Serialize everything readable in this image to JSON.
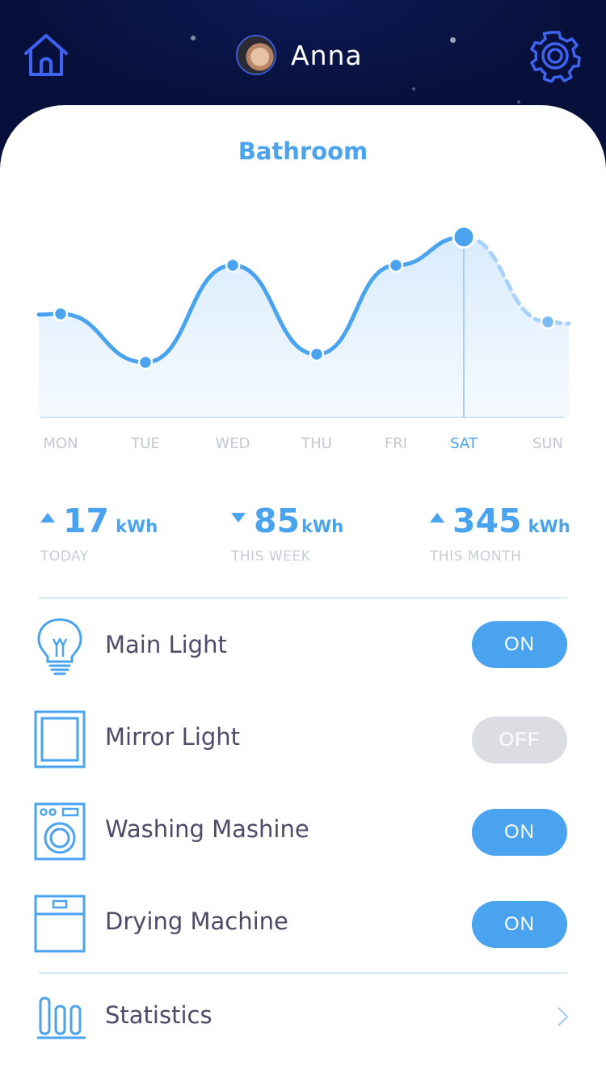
{
  "header": {
    "user_name": "Anna"
  },
  "room": {
    "title": "Bathroom"
  },
  "chart_data": {
    "type": "line",
    "categories": [
      "MON",
      "TUE",
      "WED",
      "THU",
      "FRI",
      "SAT",
      "SUN"
    ],
    "values": [
      5.2,
      2.8,
      7.6,
      3.2,
      7.6,
      9.0,
      4.8
    ],
    "selected_index": 5,
    "ylim": [
      0,
      10
    ],
    "grid": false
  },
  "stats": [
    {
      "value": "17",
      "unit": "kWh",
      "label": "TODAY",
      "trend": "up"
    },
    {
      "value": "85",
      "unit": "kWh",
      "label": "THIS WEEK",
      "trend": "down"
    },
    {
      "value": "345",
      "unit": "kWh",
      "label": "THIS MONTH",
      "trend": "up"
    }
  ],
  "devices": [
    {
      "name": "Main Light",
      "state": "ON",
      "icon": "bulb-icon"
    },
    {
      "name": "Mirror Light",
      "state": "OFF",
      "icon": "mirror-icon"
    },
    {
      "name": "Washing Mashine",
      "state": "ON",
      "icon": "washing-machine-icon"
    },
    {
      "name": "Drying Machine",
      "state": "ON",
      "icon": "drying-machine-icon"
    }
  ],
  "statistics": {
    "label": "Statistics",
    "icon": "bar-chart-icon"
  },
  "colors": {
    "accent": "#4aa3ef",
    "header_bg": "#07103a",
    "header_icon": "#3d63f0",
    "toggle_off": "#dcdde3",
    "text_dark": "#4d4a6a",
    "text_muted": "#c3c8d1"
  }
}
